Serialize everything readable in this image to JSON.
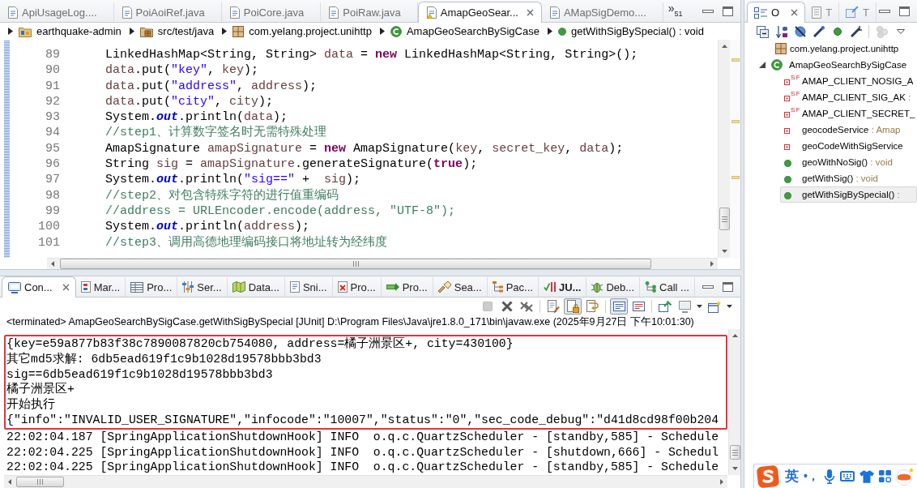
{
  "editor": {
    "tabs": [
      {
        "label": "ApiUsageLog....",
        "selected": false,
        "warning": false
      },
      {
        "label": "PoiAoiRef.java",
        "selected": false,
        "warning": false
      },
      {
        "label": "PoiCore.java",
        "selected": false,
        "warning": false
      },
      {
        "label": "PoiRaw.java",
        "selected": false,
        "warning": false
      },
      {
        "label": "AmapGeoSear...",
        "selected": true,
        "warning": true
      },
      {
        "label": "AMapSigDemo....",
        "selected": false,
        "warning": false
      }
    ],
    "overflow": {
      "glyph": "»",
      "count": "51"
    },
    "breadcrumb": [
      {
        "kind": "project",
        "label": "earthquake-admin"
      },
      {
        "kind": "source-folder",
        "label": "src/test/java"
      },
      {
        "kind": "package",
        "label": "com.yelang.project.unihttp"
      },
      {
        "kind": "class",
        "label": "AmapGeoSearchBySigCase"
      },
      {
        "kind": "method",
        "label": "getWithSigBySpecial() : void"
      }
    ],
    "lines": [
      {
        "number": "89",
        "tokens": [
          {
            "kind": "plain",
            "text": "LinkedHashMap<String, String> "
          },
          {
            "kind": "local",
            "text": "data"
          },
          {
            "kind": "plain",
            "text": " = "
          },
          {
            "kind": "keyword",
            "text": "new"
          },
          {
            "kind": "plain",
            "text": " LinkedHashMap<String, String>();"
          }
        ]
      },
      {
        "number": "90",
        "tokens": [
          {
            "kind": "local",
            "text": "data"
          },
          {
            "kind": "plain",
            "text": ".put("
          },
          {
            "kind": "string",
            "text": "\"key\""
          },
          {
            "kind": "plain",
            "text": ", "
          },
          {
            "kind": "local",
            "text": "key"
          },
          {
            "kind": "plain",
            "text": ");"
          }
        ]
      },
      {
        "number": "91",
        "tokens": [
          {
            "kind": "local",
            "text": "data"
          },
          {
            "kind": "plain",
            "text": ".put("
          },
          {
            "kind": "string",
            "text": "\"address\""
          },
          {
            "kind": "plain",
            "text": ", "
          },
          {
            "kind": "local",
            "text": "address"
          },
          {
            "kind": "plain",
            "text": ");"
          }
        ]
      },
      {
        "number": "92",
        "tokens": [
          {
            "kind": "local",
            "text": "data"
          },
          {
            "kind": "plain",
            "text": ".put("
          },
          {
            "kind": "string",
            "text": "\"city\""
          },
          {
            "kind": "plain",
            "text": ", "
          },
          {
            "kind": "local",
            "text": "city"
          },
          {
            "kind": "plain",
            "text": ");"
          }
        ]
      },
      {
        "number": "93",
        "tokens": [
          {
            "kind": "plain",
            "text": "System."
          },
          {
            "kind": "static",
            "text": "out"
          },
          {
            "kind": "plain",
            "text": ".println("
          },
          {
            "kind": "local",
            "text": "data"
          },
          {
            "kind": "plain",
            "text": ");"
          }
        ]
      },
      {
        "number": "94",
        "tokens": [
          {
            "kind": "comment",
            "text": "//step1、计算数字签名时无需特殊处理"
          }
        ]
      },
      {
        "number": "95",
        "tokens": [
          {
            "kind": "plain",
            "text": "AmapSignature "
          },
          {
            "kind": "local",
            "text": "amapSignature"
          },
          {
            "kind": "plain",
            "text": " = "
          },
          {
            "kind": "keyword",
            "text": "new"
          },
          {
            "kind": "plain",
            "text": " AmapSignature("
          },
          {
            "kind": "local",
            "text": "key"
          },
          {
            "kind": "plain",
            "text": ", "
          },
          {
            "kind": "local",
            "text": "secret_key"
          },
          {
            "kind": "plain",
            "text": ", "
          },
          {
            "kind": "local",
            "text": "data"
          },
          {
            "kind": "plain",
            "text": ");"
          }
        ]
      },
      {
        "number": "96",
        "tokens": [
          {
            "kind": "plain",
            "text": "String "
          },
          {
            "kind": "local",
            "text": "sig"
          },
          {
            "kind": "plain",
            "text": " = "
          },
          {
            "kind": "local",
            "text": "amapSignature"
          },
          {
            "kind": "plain",
            "text": ".generateSignature("
          },
          {
            "kind": "keyword",
            "text": "true"
          },
          {
            "kind": "plain",
            "text": ");"
          }
        ]
      },
      {
        "number": "97",
        "tokens": [
          {
            "kind": "plain",
            "text": "System."
          },
          {
            "kind": "static",
            "text": "out"
          },
          {
            "kind": "plain",
            "text": ".println("
          },
          {
            "kind": "string",
            "text": "\"sig==\""
          },
          {
            "kind": "plain",
            "text": " +  "
          },
          {
            "kind": "local",
            "text": "sig"
          },
          {
            "kind": "plain",
            "text": ");"
          }
        ]
      },
      {
        "number": "98",
        "tokens": [
          {
            "kind": "comment",
            "text": "//step2、对包含特殊字符的进行值重编码"
          }
        ]
      },
      {
        "number": "99",
        "tokens": [
          {
            "kind": "comment",
            "text": "//address = URLEncoder.encode(address, \"UTF-8\");"
          }
        ]
      },
      {
        "number": "100",
        "tokens": [
          {
            "kind": "plain",
            "text": "System."
          },
          {
            "kind": "static",
            "text": "out"
          },
          {
            "kind": "plain",
            "text": ".println("
          },
          {
            "kind": "local",
            "text": "address"
          },
          {
            "kind": "plain",
            "text": ");"
          }
        ]
      },
      {
        "number": "101",
        "tokens": [
          {
            "kind": "comment",
            "text": "//step3、调用高德地理编码接口将地址转为经纬度"
          }
        ]
      }
    ]
  },
  "console": {
    "tabs": [
      {
        "kind": "console",
        "label": "Con...",
        "selected": true,
        "changed": false
      },
      {
        "kind": "markers",
        "label": "Mar...",
        "selected": false,
        "changed": false
      },
      {
        "kind": "properties",
        "label": "Pro...",
        "selected": false,
        "changed": false
      },
      {
        "kind": "servers",
        "label": "Ser...",
        "selected": false,
        "changed": false
      },
      {
        "kind": "data-source",
        "label": "Data...",
        "selected": false,
        "changed": false
      },
      {
        "kind": "snippets",
        "label": "Sni...",
        "selected": false,
        "changed": false
      },
      {
        "kind": "problems",
        "label": "Pro...",
        "selected": false,
        "changed": false
      },
      {
        "kind": "progress",
        "label": "Pro...",
        "selected": false,
        "changed": false
      },
      {
        "kind": "search",
        "label": "Sea...",
        "selected": false,
        "changed": false
      },
      {
        "kind": "package-explorer",
        "label": "Pac...",
        "selected": false,
        "changed": false
      },
      {
        "kind": "junit",
        "label": "JU...",
        "selected": false,
        "changed": true
      },
      {
        "kind": "debug",
        "label": "Deb...",
        "selected": false,
        "changed": false
      },
      {
        "kind": "call-hierarchy",
        "label": "Call ...",
        "selected": false,
        "changed": false
      }
    ],
    "toolbar": [
      [
        {
          "kind": "terminate",
          "disabled": true,
          "pressed": false
        },
        {
          "kind": "remove-launch",
          "disabled": false,
          "pressed": false
        },
        {
          "kind": "remove-all",
          "disabled": false,
          "pressed": false
        }
      ],
      [
        {
          "kind": "clear",
          "disabled": false,
          "pressed": false
        },
        {
          "kind": "scroll-lock",
          "disabled": false,
          "pressed": true
        },
        {
          "kind": "word-wrap",
          "disabled": false,
          "pressed": false
        }
      ],
      [
        {
          "kind": "show-on-stdout",
          "disabled": false,
          "pressed": true
        },
        {
          "kind": "show-on-stderr",
          "disabled": false,
          "pressed": false
        }
      ],
      [
        {
          "kind": "pin",
          "disabled": false,
          "pressed": false
        },
        {
          "kind": "display-console",
          "disabled": false,
          "pressed": false
        },
        {
          "kind": "new-console",
          "disabled": false,
          "pressed": false
        }
      ]
    ],
    "description": "<terminated> AmapGeoSearchBySigCase.getWithSigBySpecial [JUnit] D:\\Program Files\\Java\\jre1.8.0_171\\bin\\javaw.exe (2025年9月27日 下午10:01:30)",
    "highlighted_lines": [
      "{key=e59a877b83f38c7890087820cb754080, address=橘子洲景区+, city=430100}",
      "其它md5求解: 6db5ead619f1c9b1028d19578bbb3bd3",
      "sig==6db5ead619f1c9b1028d19578bbb3bd3",
      "橘子洲景区+",
      "开始执行",
      "{\"info\":\"INVALID_USER_SIGNATURE\",\"infocode\":\"10007\",\"status\":\"0\",\"sec_code_debug\":\"d41d8cd98f00b204"
    ],
    "lines": [
      "22:02:04.187 [SpringApplicationShutdownHook] INFO  o.q.c.QuartzScheduler - [standby,585] - Schedule",
      "22:02:04.225 [SpringApplicationShutdownHook] INFO  o.q.c.QuartzScheduler - [shutdown,666] - Schedul",
      "22:02:04.225 [SpringApplicationShutdownHook] INFO  o.q.c.QuartzScheduler - [standby,585] - Schedule"
    ]
  },
  "outline": {
    "tabs": [
      {
        "kind": "outline",
        "label": "O",
        "selected": true
      },
      {
        "kind": "tasks",
        "label": "T",
        "selected": false
      },
      {
        "kind": "hierarchy",
        "label": "T",
        "selected": false
      }
    ],
    "toolbar": [
      [
        {
          "kind": "collapse-all",
          "disabled": false
        },
        {
          "kind": "sort",
          "disabled": false
        },
        {
          "kind": "hide-fields",
          "disabled": false
        },
        {
          "kind": "hide-static",
          "disabled": false
        },
        {
          "kind": "hide-non-public",
          "disabled": false
        },
        {
          "kind": "hide-local-types",
          "disabled": false
        }
      ],
      [
        {
          "kind": "link",
          "disabled": true
        },
        {
          "kind": "view-menu",
          "disabled": false
        }
      ]
    ],
    "package": {
      "label": "com.yelang.project.unihttp"
    },
    "type": {
      "label": "AmapGeoSearchBySigCase",
      "expanded": true,
      "members": [
        {
          "kind": "constant",
          "flags": "SF",
          "name": "AMAP_CLIENT_NOSIG_A",
          "selected": false
        },
        {
          "kind": "constant",
          "flags": "SF",
          "name": "AMAP_CLIENT_SIG_AK",
          "type": " :",
          "selected": false
        },
        {
          "kind": "constant",
          "flags": "SF",
          "name": "AMAP_CLIENT_SECRET_",
          "selected": false
        },
        {
          "kind": "field",
          "name": "geocodeService",
          "type": " : Amap",
          "selected": false
        },
        {
          "kind": "field",
          "name": "geoCodeWithSigService",
          "selected": false
        },
        {
          "kind": "method",
          "name": "geoWithNoSig()",
          "type": " : void",
          "selected": false
        },
        {
          "kind": "method",
          "name": "getWithSig()",
          "type": " : void",
          "selected": false
        },
        {
          "kind": "method",
          "name": "getWithSigBySpecial()",
          "type": " :",
          "selected": true
        }
      ]
    }
  },
  "ime": {
    "language": "英",
    "punctuation": "•，"
  }
}
